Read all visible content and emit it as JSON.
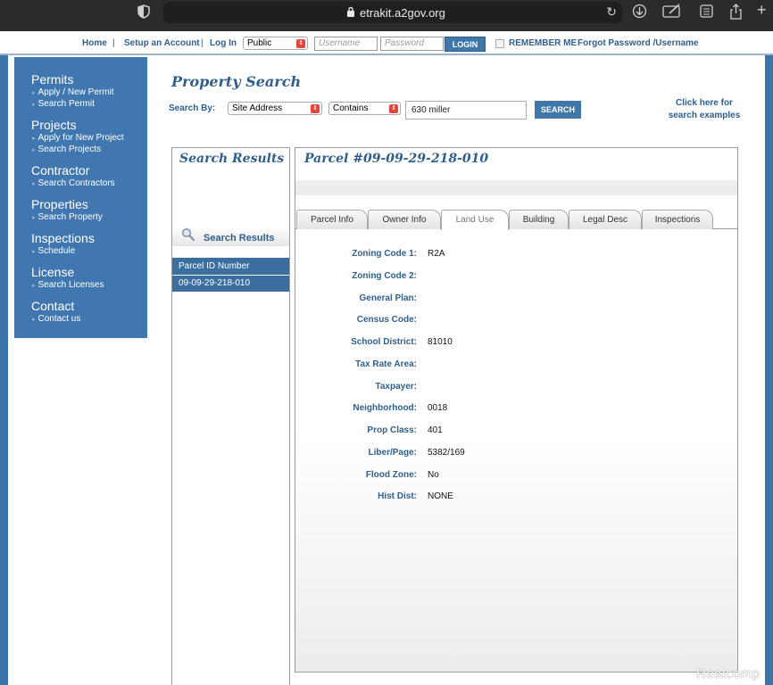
{
  "browser": {
    "url": "etrakit.a2gov.org"
  },
  "topnav": {
    "home": "Home",
    "sep": "|",
    "setup_account": "Setup an Account",
    "log_in": "Log In",
    "user_type": "Public",
    "username_placeholder": "Username",
    "password_placeholder": "Password",
    "login_button": "LOGIN",
    "remember_me": "REMEMBER ME",
    "forgot": "Forgot Password /Username"
  },
  "sidebar": {
    "sections": [
      {
        "heading": "Permits",
        "items": [
          "Apply / New Permit",
          "Search Permit"
        ]
      },
      {
        "heading": "Projects",
        "items": [
          "Apply for New Project",
          "Search Projects"
        ]
      },
      {
        "heading": "Contractor",
        "items": [
          "Search Contractors"
        ]
      },
      {
        "heading": "Properties",
        "items": [
          "Search Property"
        ]
      },
      {
        "heading": "Inspections",
        "items": [
          "Schedule"
        ]
      },
      {
        "heading": "License",
        "items": [
          "Search Licenses"
        ]
      },
      {
        "heading": "Contact",
        "items": [
          "Contact us"
        ]
      }
    ]
  },
  "search": {
    "title": "Property Search",
    "by_label": "Search By:",
    "field": "Site Address",
    "operator": "Contains",
    "value": "630 miller",
    "button": "SEARCH",
    "examples_link": "Click here for search examples"
  },
  "results": {
    "title": "Search Results",
    "subheading": "Search Results",
    "column_header": "Parcel ID Number",
    "rows": [
      "09-09-29-218-010"
    ]
  },
  "parcel": {
    "title": "Parcel #09-09-29-218-010",
    "tabs": [
      "Parcel Info",
      "Owner Info",
      "Land Use",
      "Building",
      "Legal Desc",
      "Inspections"
    ],
    "active_tab": "Land Use",
    "fields": [
      {
        "label": "Zoning Code 1:",
        "value": "R2A"
      },
      {
        "label": "Zoning Code 2:",
        "value": ""
      },
      {
        "label": "General Plan:",
        "value": ""
      },
      {
        "label": "Census Code:",
        "value": ""
      },
      {
        "label": "School District:",
        "value": "81010"
      },
      {
        "label": "Tax Rate Area:",
        "value": ""
      },
      {
        "label": "Taxpayer:",
        "value": ""
      },
      {
        "label": "Neighborhood:",
        "value": "0018"
      },
      {
        "label": "Prop Class:",
        "value": "401"
      },
      {
        "label": "Liber/Page:",
        "value": "5382/169"
      },
      {
        "label": "Flood Zone:",
        "value": "No"
      },
      {
        "label": "Hist Dist:",
        "value": "NONE"
      }
    ]
  },
  "watermark": "Realcomp",
  "colors": {
    "brand_blue": "#4077b0",
    "link_blue": "#2f5f8c",
    "button_blue": "#3f78a8"
  }
}
